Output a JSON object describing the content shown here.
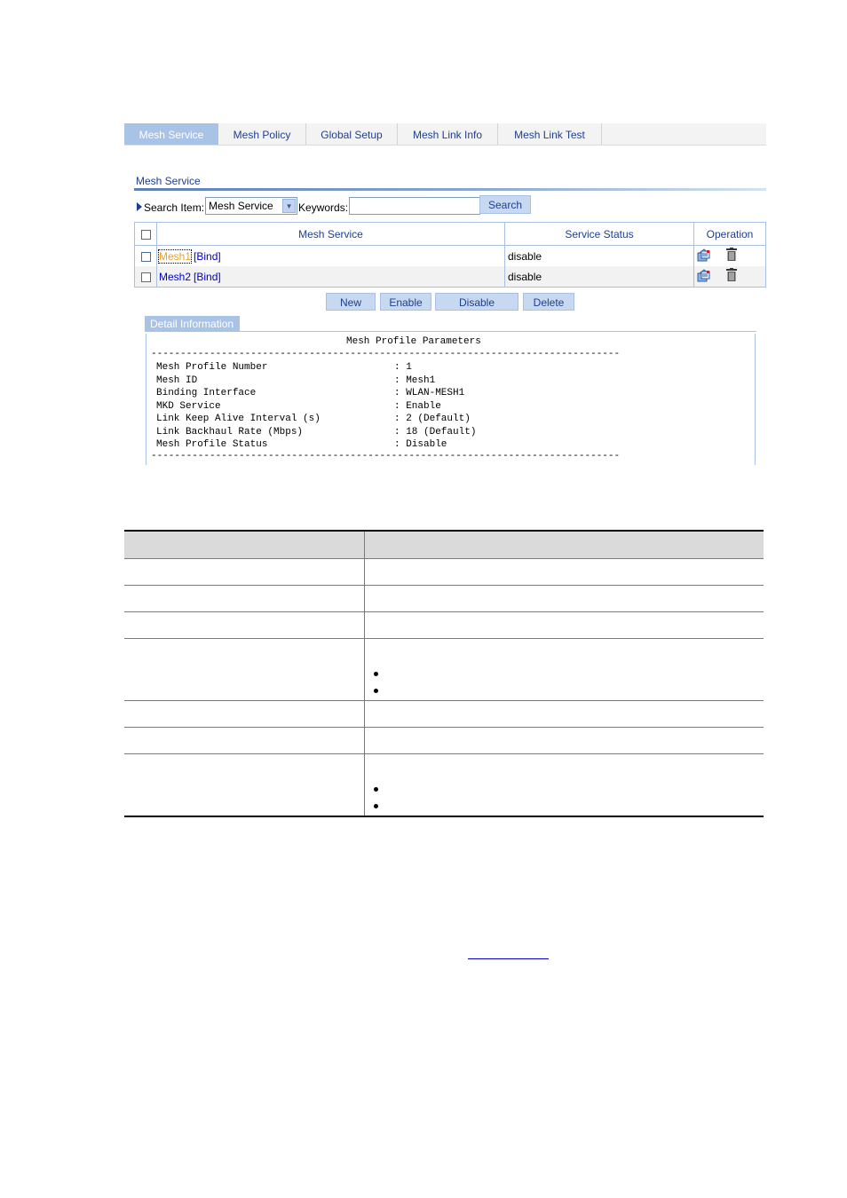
{
  "tabs": [
    {
      "label": "Mesh Service",
      "active": true
    },
    {
      "label": "Mesh Policy",
      "active": false
    },
    {
      "label": "Global Setup",
      "active": false
    },
    {
      "label": "Mesh Link Info",
      "active": false
    },
    {
      "label": "Mesh Link Test",
      "active": false
    }
  ],
  "section_title": "Mesh Service",
  "search": {
    "item_label": "Search Item:",
    "item_selected": "Mesh Service",
    "keywords_label": "Keywords:",
    "keywords_value": "",
    "button": "Search"
  },
  "service_table": {
    "columns": [
      "Mesh Service",
      "Service Status",
      "Operation"
    ],
    "rows": [
      {
        "name": "Mesh1",
        "bind": "[Bind]",
        "status": "disable"
      },
      {
        "name": "Mesh2",
        "bind": "[Bind]",
        "status": "disable"
      }
    ]
  },
  "actions": {
    "new": "New",
    "enable": "Enable",
    "disable": "Disable",
    "delete": "Delete"
  },
  "detail": {
    "tab_label": "Detail Information",
    "title": "Mesh Profile Parameters",
    "separator": "--------------------------------------------------------------------------------",
    "params": [
      {
        "name": "Mesh Profile Number",
        "value": "1"
      },
      {
        "name": "Mesh ID",
        "value": "Mesh1"
      },
      {
        "name": "Binding Interface",
        "value": "WLAN-MESH1"
      },
      {
        "name": "MKD Service",
        "value": "Enable"
      },
      {
        "name": "Link Keep Alive Interval (s)",
        "value": "2 (Default)"
      },
      {
        "name": "Link Backhaul Rate (Mbps)",
        "value": "18 (Default)"
      },
      {
        "name": "Mesh Profile Status",
        "value": "Disable"
      }
    ]
  },
  "icons": {
    "edit": "edit-icon",
    "delete": "trash-icon"
  },
  "colors": {
    "accent": "#a9c3e6",
    "link": "#0000cc",
    "focus_link": "#f0a020",
    "header_text": "#1f3f8f"
  }
}
